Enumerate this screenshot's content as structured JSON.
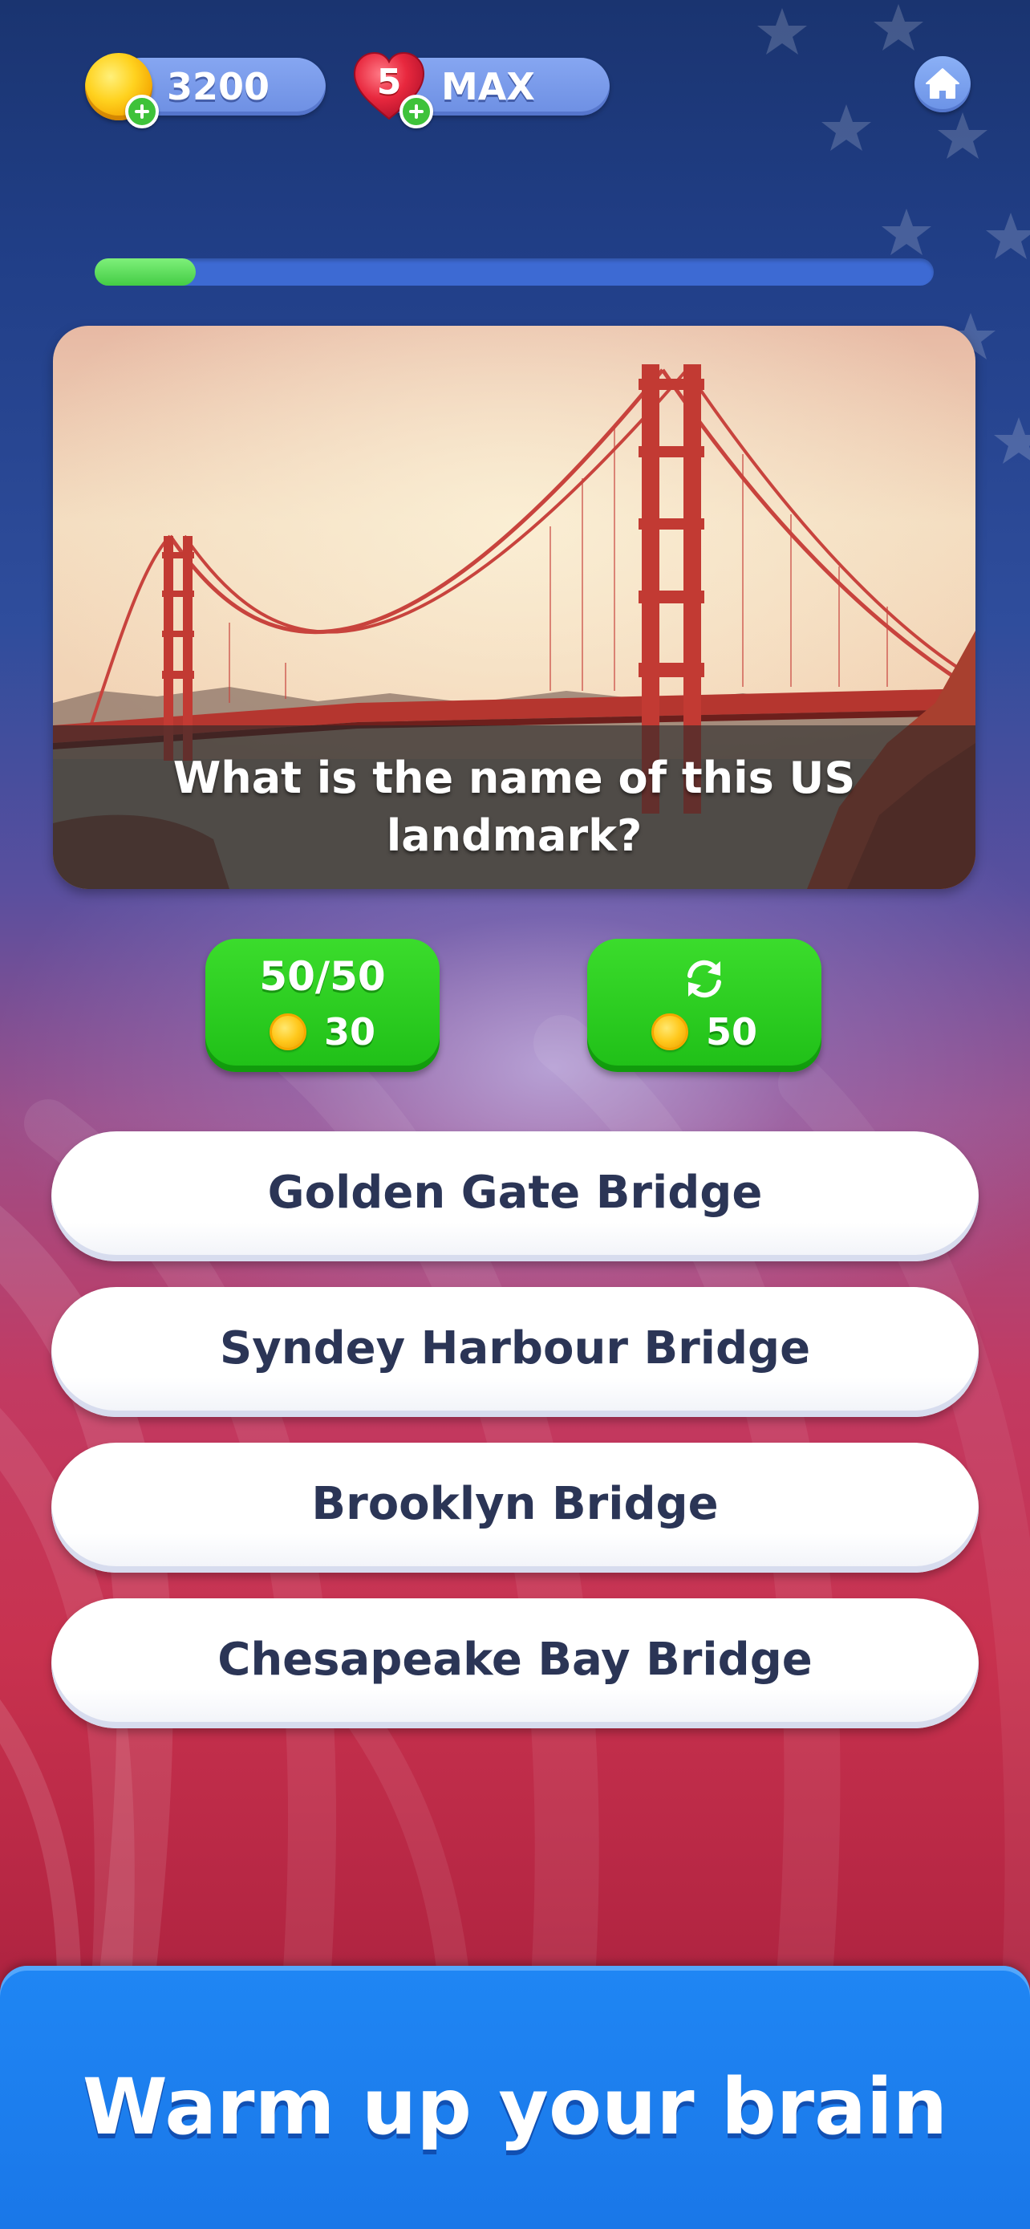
{
  "header": {
    "coins": "3200",
    "lives_count": "5",
    "lives_label": "MAX"
  },
  "progress": {
    "fraction": 0.12
  },
  "question": {
    "text": "What is the name of this US landmark?"
  },
  "powerups": {
    "fifty_fifty": {
      "label": "50/50",
      "cost": "30"
    },
    "swap": {
      "icon": "refresh-icon",
      "cost": "50"
    }
  },
  "answers": [
    {
      "label": "Golden Gate Bridge"
    },
    {
      "label": "Syndey Harbour Bridge"
    },
    {
      "label": "Brooklyn Bridge"
    },
    {
      "label": "Chesapeake Bay Bridge"
    }
  ],
  "footer": {
    "text": "Warm up your brain"
  },
  "colors": {
    "progress_fill": "#44cc45",
    "powerup_green": "#1fbf17",
    "answer_text": "#2b3556",
    "footer_blue": "#1a77e8"
  }
}
